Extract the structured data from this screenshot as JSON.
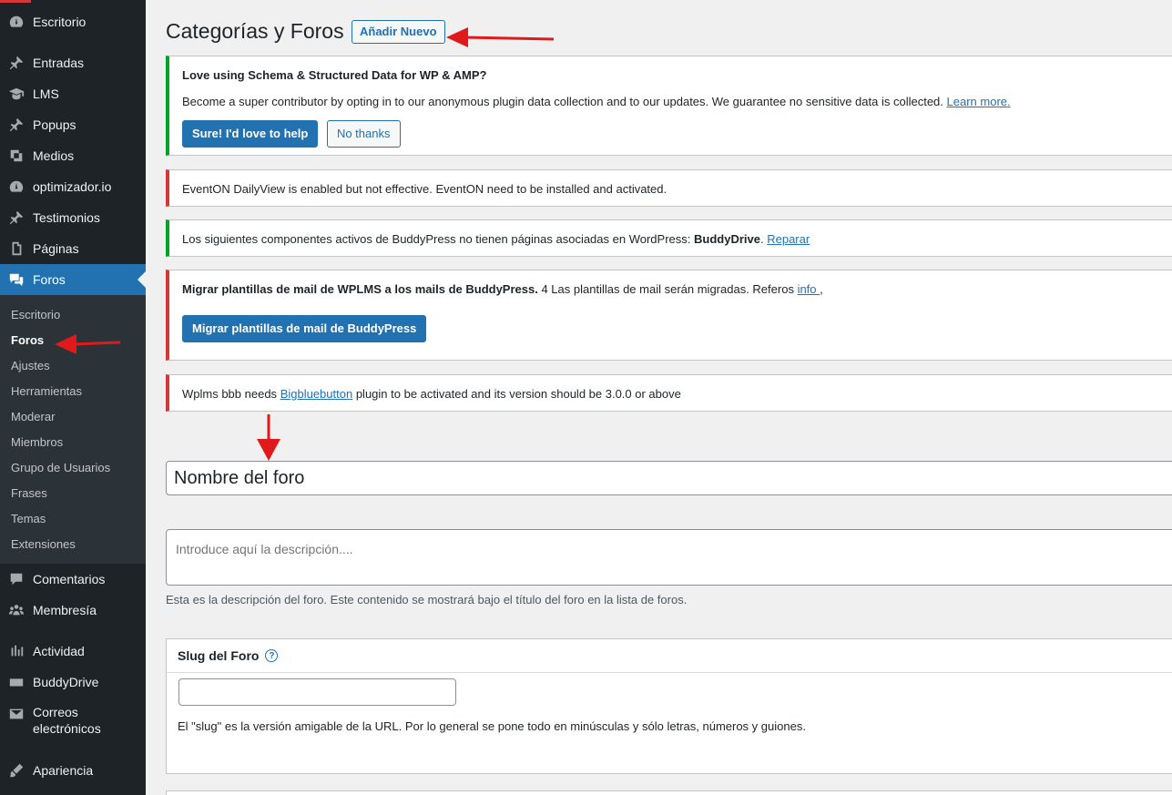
{
  "sidebar": {
    "items": [
      {
        "label": "Escritorio",
        "icon": "dashboard-icon"
      },
      {
        "label": "Entradas",
        "icon": "pin-icon"
      },
      {
        "label": "LMS",
        "icon": "graduation-cap-icon"
      },
      {
        "label": "Popups",
        "icon": "pin-icon"
      },
      {
        "label": "Medios",
        "icon": "media-icon"
      },
      {
        "label": "optimizador.io",
        "icon": "dashboard-icon"
      },
      {
        "label": "Testimonios",
        "icon": "pin-icon"
      },
      {
        "label": "Páginas",
        "icon": "page-icon"
      },
      {
        "label": "Foros",
        "icon": "forums-icon"
      },
      {
        "label": "Comentarios",
        "icon": "comments-icon"
      },
      {
        "label": "Membresía",
        "icon": "groups-icon"
      },
      {
        "label": "Actividad",
        "icon": "activity-icon"
      },
      {
        "label": "BuddyDrive",
        "icon": "drive-icon"
      },
      {
        "label": "Correos",
        "label2": "electrónicos",
        "icon": "email-icon"
      },
      {
        "label": "Apariencia",
        "icon": "appearance-icon"
      }
    ],
    "submenu": [
      "Escritorio",
      "Foros",
      "Ajustes",
      "Herramientas",
      "Moderar",
      "Miembros",
      "Grupo de Usuarios",
      "Frases",
      "Temas",
      "Extensiones"
    ]
  },
  "header": {
    "title": "Categorías y Foros",
    "add_new": "Añadir Nuevo"
  },
  "notices": {
    "schema": {
      "heading": "Love using Schema & Structured Data for WP & AMP?",
      "text": "Become a super contributor by opting in to our anonymous plugin data collection and to our updates. We guarantee no sensitive data is collected.",
      "link": "Learn more.",
      "accept": "Sure! I'd love to help",
      "decline": "No thanks"
    },
    "eventon": {
      "text": "EventON DailyView is enabled but not effective. EventON need to be installed and activated."
    },
    "buddypress": {
      "text": "Los siguientes componentes activos de BuddyPress no tienen páginas asociadas en WordPress:",
      "bold": "BuddyDrive",
      "period": ".",
      "link": "Reparar"
    },
    "migrate": {
      "bold": "Migrar plantillas de mail de WPLMS a los mails de BuddyPress.",
      "text": "4 Las plantillas de mail serán migradas. Referos",
      "link": "info ",
      "comma": ",",
      "button": "Migrar plantillas de mail de BuddyPress"
    },
    "wplms": {
      "before": "Wplms bbb needs",
      "link": "Bigbluebutton",
      "after": "plugin to be activated and its version should be 3.0.0 or above"
    }
  },
  "form": {
    "title_value": "Nombre del foro",
    "description_placeholder": "Introduce aquí la descripción....",
    "description_help": "Esta es la descripción del foro. Este contenido se mostrará bajo el título del foro en la lista de foros.",
    "slug_label": "Slug del Foro",
    "slug_help_icon": "?",
    "slug_value": "",
    "slug_help": "El \"slug\" es la versión amigable de la URL. Por lo general se pone todo en minúsculas y sólo letras, números y guiones."
  },
  "colors": {
    "sidebar": "#1d2327",
    "submenu": "#2c3338",
    "accent": "#2271b1",
    "success": "#00a32a",
    "error": "#d63638",
    "annotation_arrow": "#e0191b"
  }
}
